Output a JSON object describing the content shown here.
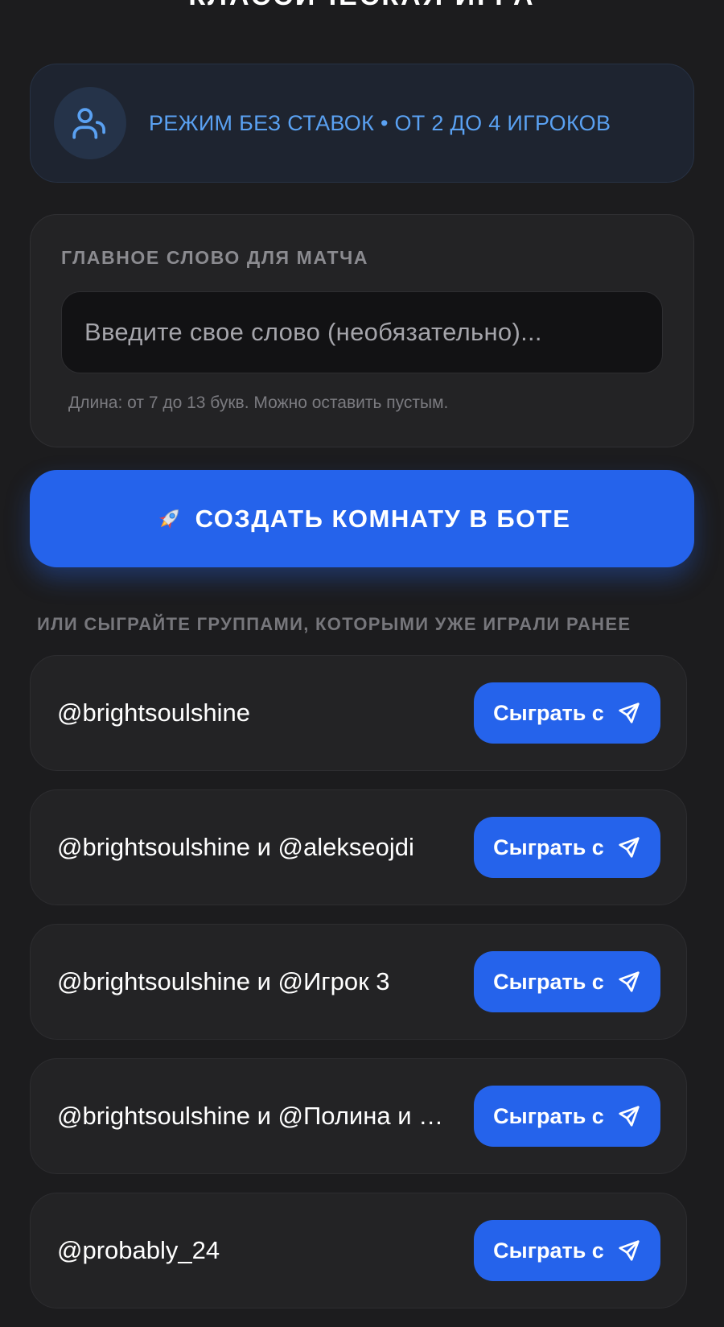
{
  "header": {
    "title": "КЛАССИЧЕСКАЯ ИГРА"
  },
  "mode": {
    "icon": "users-icon",
    "text": "РЕЖИМ БЕЗ СТАВОК • ОТ 2 ДО 4 ИГРОКОВ"
  },
  "word_section": {
    "label": "ГЛАВНОЕ СЛОВО ДЛЯ МАТЧА",
    "input_value": "",
    "input_placeholder": "Введите свое слово (необязательно)...",
    "hint": "Длина: от 7 до 13 букв. Можно оставить пустым."
  },
  "create_button": {
    "icon": "rocket-icon",
    "label": "СОЗДАТЬ КОМНАТУ В БОТЕ"
  },
  "groups": {
    "label": "ИЛИ СЫГРАЙТЕ ГРУППАМИ, КОТОРЫМИ УЖЕ ИГРАЛИ РАНЕЕ",
    "items": [
      {
        "name": "@brightsoulshine",
        "button_label": "Сыграть с"
      },
      {
        "name": "@brightsoulshine и @alekseojdi",
        "button_label": "Сыграть с"
      },
      {
        "name": "@brightsoulshine и @Игрок 3",
        "button_label": "Сыграть с"
      },
      {
        "name": "@brightsoulshine и @Полина и …",
        "button_label": "Сыграть с"
      },
      {
        "name": "@probably_24",
        "button_label": "Сыграть с"
      }
    ]
  },
  "colors": {
    "background": "#1c1c1e",
    "accent": "#2563eb",
    "mode_text": "#5aa1f2",
    "card": "#232325"
  }
}
